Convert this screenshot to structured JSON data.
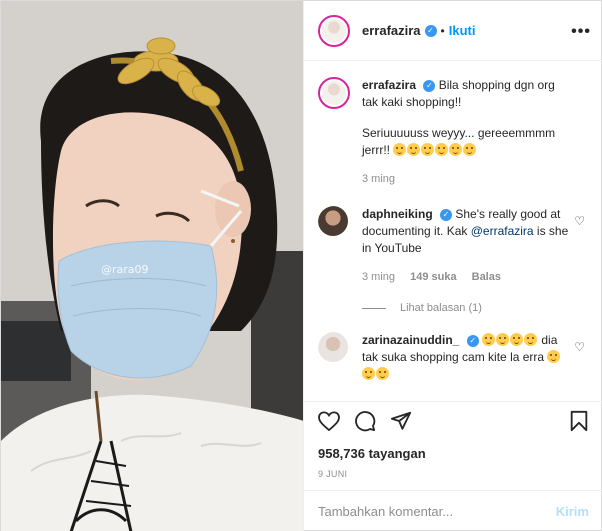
{
  "media": {
    "watermark": "@rara09"
  },
  "header": {
    "username": "errafazira",
    "separator": "•",
    "follow_label": "Ikuti",
    "more_icon": "more-horizontal-icon"
  },
  "caption": {
    "username": "errafazira",
    "line1": "Bila shopping dgn org tak kaki shopping!!",
    "line2": "Seriuuuuuss weyyy... gereeemmmm jerrr!!",
    "time": "3 ming"
  },
  "comments": [
    {
      "username": "daphneiking",
      "text_before": "She's really good at documenting it. Kak ",
      "mention": "@errafazira",
      "text_after": " is she in YouTube",
      "time": "3 ming",
      "likes": "149 suka",
      "reply_label": "Balas",
      "view_replies": "Lihat balasan (1)"
    },
    {
      "username": "zarinazainuddin_",
      "text_mid": " dia tak suka shopping cam kite la erra"
    }
  ],
  "actions": {
    "views": "958,736 tayangan",
    "date": "9 JUNI"
  },
  "add_comment": {
    "placeholder": "Tambahkan komentar...",
    "send_label": "Kirim"
  },
  "colors": {
    "link": "#0095f6",
    "verified": "#3897f0",
    "send_disabled": "#b2dffc",
    "muted": "#8e8e8e"
  }
}
